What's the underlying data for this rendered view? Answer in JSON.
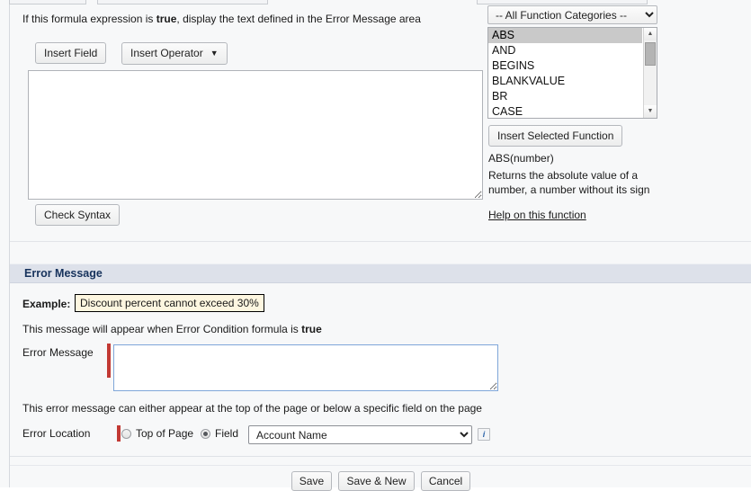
{
  "formula": {
    "hint_prefix": "If this formula expression is ",
    "hint_bold": "true",
    "hint_suffix": ", display the text defined in the Error Message area",
    "insert_field_label": "Insert Field",
    "insert_operator_label": "Insert Operator",
    "insert_operator_caret": "▼",
    "formula_value": "",
    "formula_placeholder": "",
    "check_syntax_label": "Check Syntax"
  },
  "functions": {
    "category_selected": "-- All Function Categories --",
    "category_options": [
      "-- All Function Categories --"
    ],
    "list": [
      {
        "label": "ABS",
        "selected": true
      },
      {
        "label": "AND",
        "selected": false
      },
      {
        "label": "BEGINS",
        "selected": false
      },
      {
        "label": "BLANKVALUE",
        "selected": false
      },
      {
        "label": "BR",
        "selected": false
      },
      {
        "label": "CASE",
        "selected": false
      }
    ],
    "insert_selected_label": "Insert Selected Function",
    "signature": "ABS(number)",
    "description": "Returns the absolute value of a number, a number without its sign",
    "help_link": "Help on this function",
    "scroll_up_glyph": "▲",
    "scroll_down_glyph": "▼"
  },
  "error_message": {
    "section_title": "Error Message",
    "example_label": "Example:",
    "example_value": "Discount percent cannot exceed 30%",
    "appear_note_prefix": "This message will appear when Error Condition formula is ",
    "appear_note_bold": "true",
    "errmsg_label": "Error Message",
    "errmsg_value": "",
    "location_note": "This error message can either appear at the top of the page or below a specific field on the page",
    "errloc_label": "Error Location",
    "radio_top_label": "Top of Page",
    "radio_top_selected": false,
    "radio_field_label": "Field",
    "radio_field_selected": true,
    "field_selected": "Account Name",
    "field_options": [
      "Account Name"
    ],
    "info_icon_glyph": "i"
  },
  "footer": {
    "save_label": "Save",
    "save_new_label": "Save & New",
    "cancel_label": "Cancel"
  },
  "colors": {
    "required_bar": "#c23934",
    "section_header_bg": "#dde1ea",
    "section_header_text": "#16325c",
    "example_bg": "#fdf6e0",
    "focus_border": "#7fa6d9",
    "info_icon_text": "#2a62a8"
  }
}
